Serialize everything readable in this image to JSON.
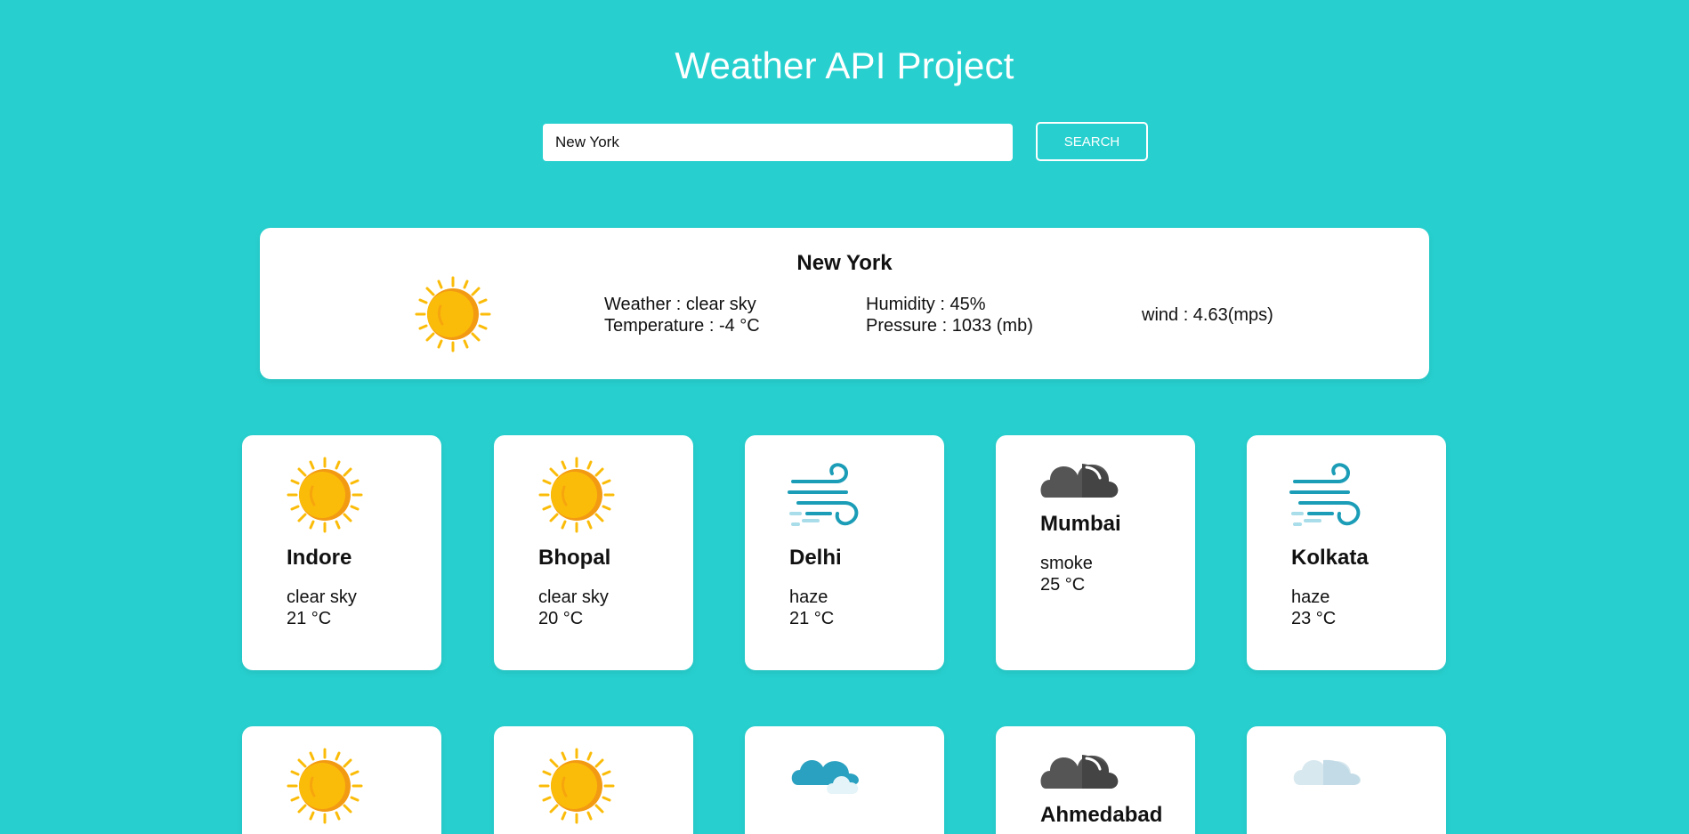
{
  "page_title": "Weather API Project",
  "search": {
    "value": "New York",
    "button_label": "SEARCH"
  },
  "current": {
    "city": "New York",
    "weather": "Weather : clear sky",
    "temperature": "Temperature : -4 °C",
    "humidity": "Humidity : 45%",
    "pressure": "Pressure : 1033 (mb)",
    "wind": "wind : 4.63(mps)",
    "icon": "sun-icon"
  },
  "cities": [
    {
      "name": "Indore",
      "description": "clear sky",
      "temperature": "21 °C",
      "icon": "sun-icon"
    },
    {
      "name": "Bhopal",
      "description": "clear sky",
      "temperature": "20 °C",
      "icon": "sun-icon"
    },
    {
      "name": "Delhi",
      "description": "haze",
      "temperature": "21 °C",
      "icon": "wind-icon"
    },
    {
      "name": "Mumbai",
      "description": "smoke",
      "temperature": "25 °C",
      "icon": "dark-cloud-icon"
    },
    {
      "name": "Kolkata",
      "description": "haze",
      "temperature": "23 °C",
      "icon": "wind-icon"
    }
  ],
  "cities_row_2": [
    {
      "name": "",
      "icon": "sun-icon"
    },
    {
      "name": "",
      "icon": "sun-icon"
    },
    {
      "name": "",
      "icon": "blue-cloud-icon"
    },
    {
      "name": "Ahmedabad",
      "icon": "dark-cloud-icon"
    },
    {
      "name": "",
      "icon": "light-cloud-icon"
    }
  ],
  "colors": {
    "background": "#27d0cf",
    "card": "#ffffff",
    "sun": "#fbbc09",
    "wind": "#1c9db7",
    "dark_cloud": "#555555",
    "blue_cloud": "#2aa1c0",
    "light_cloud": "#d8e8ef"
  }
}
